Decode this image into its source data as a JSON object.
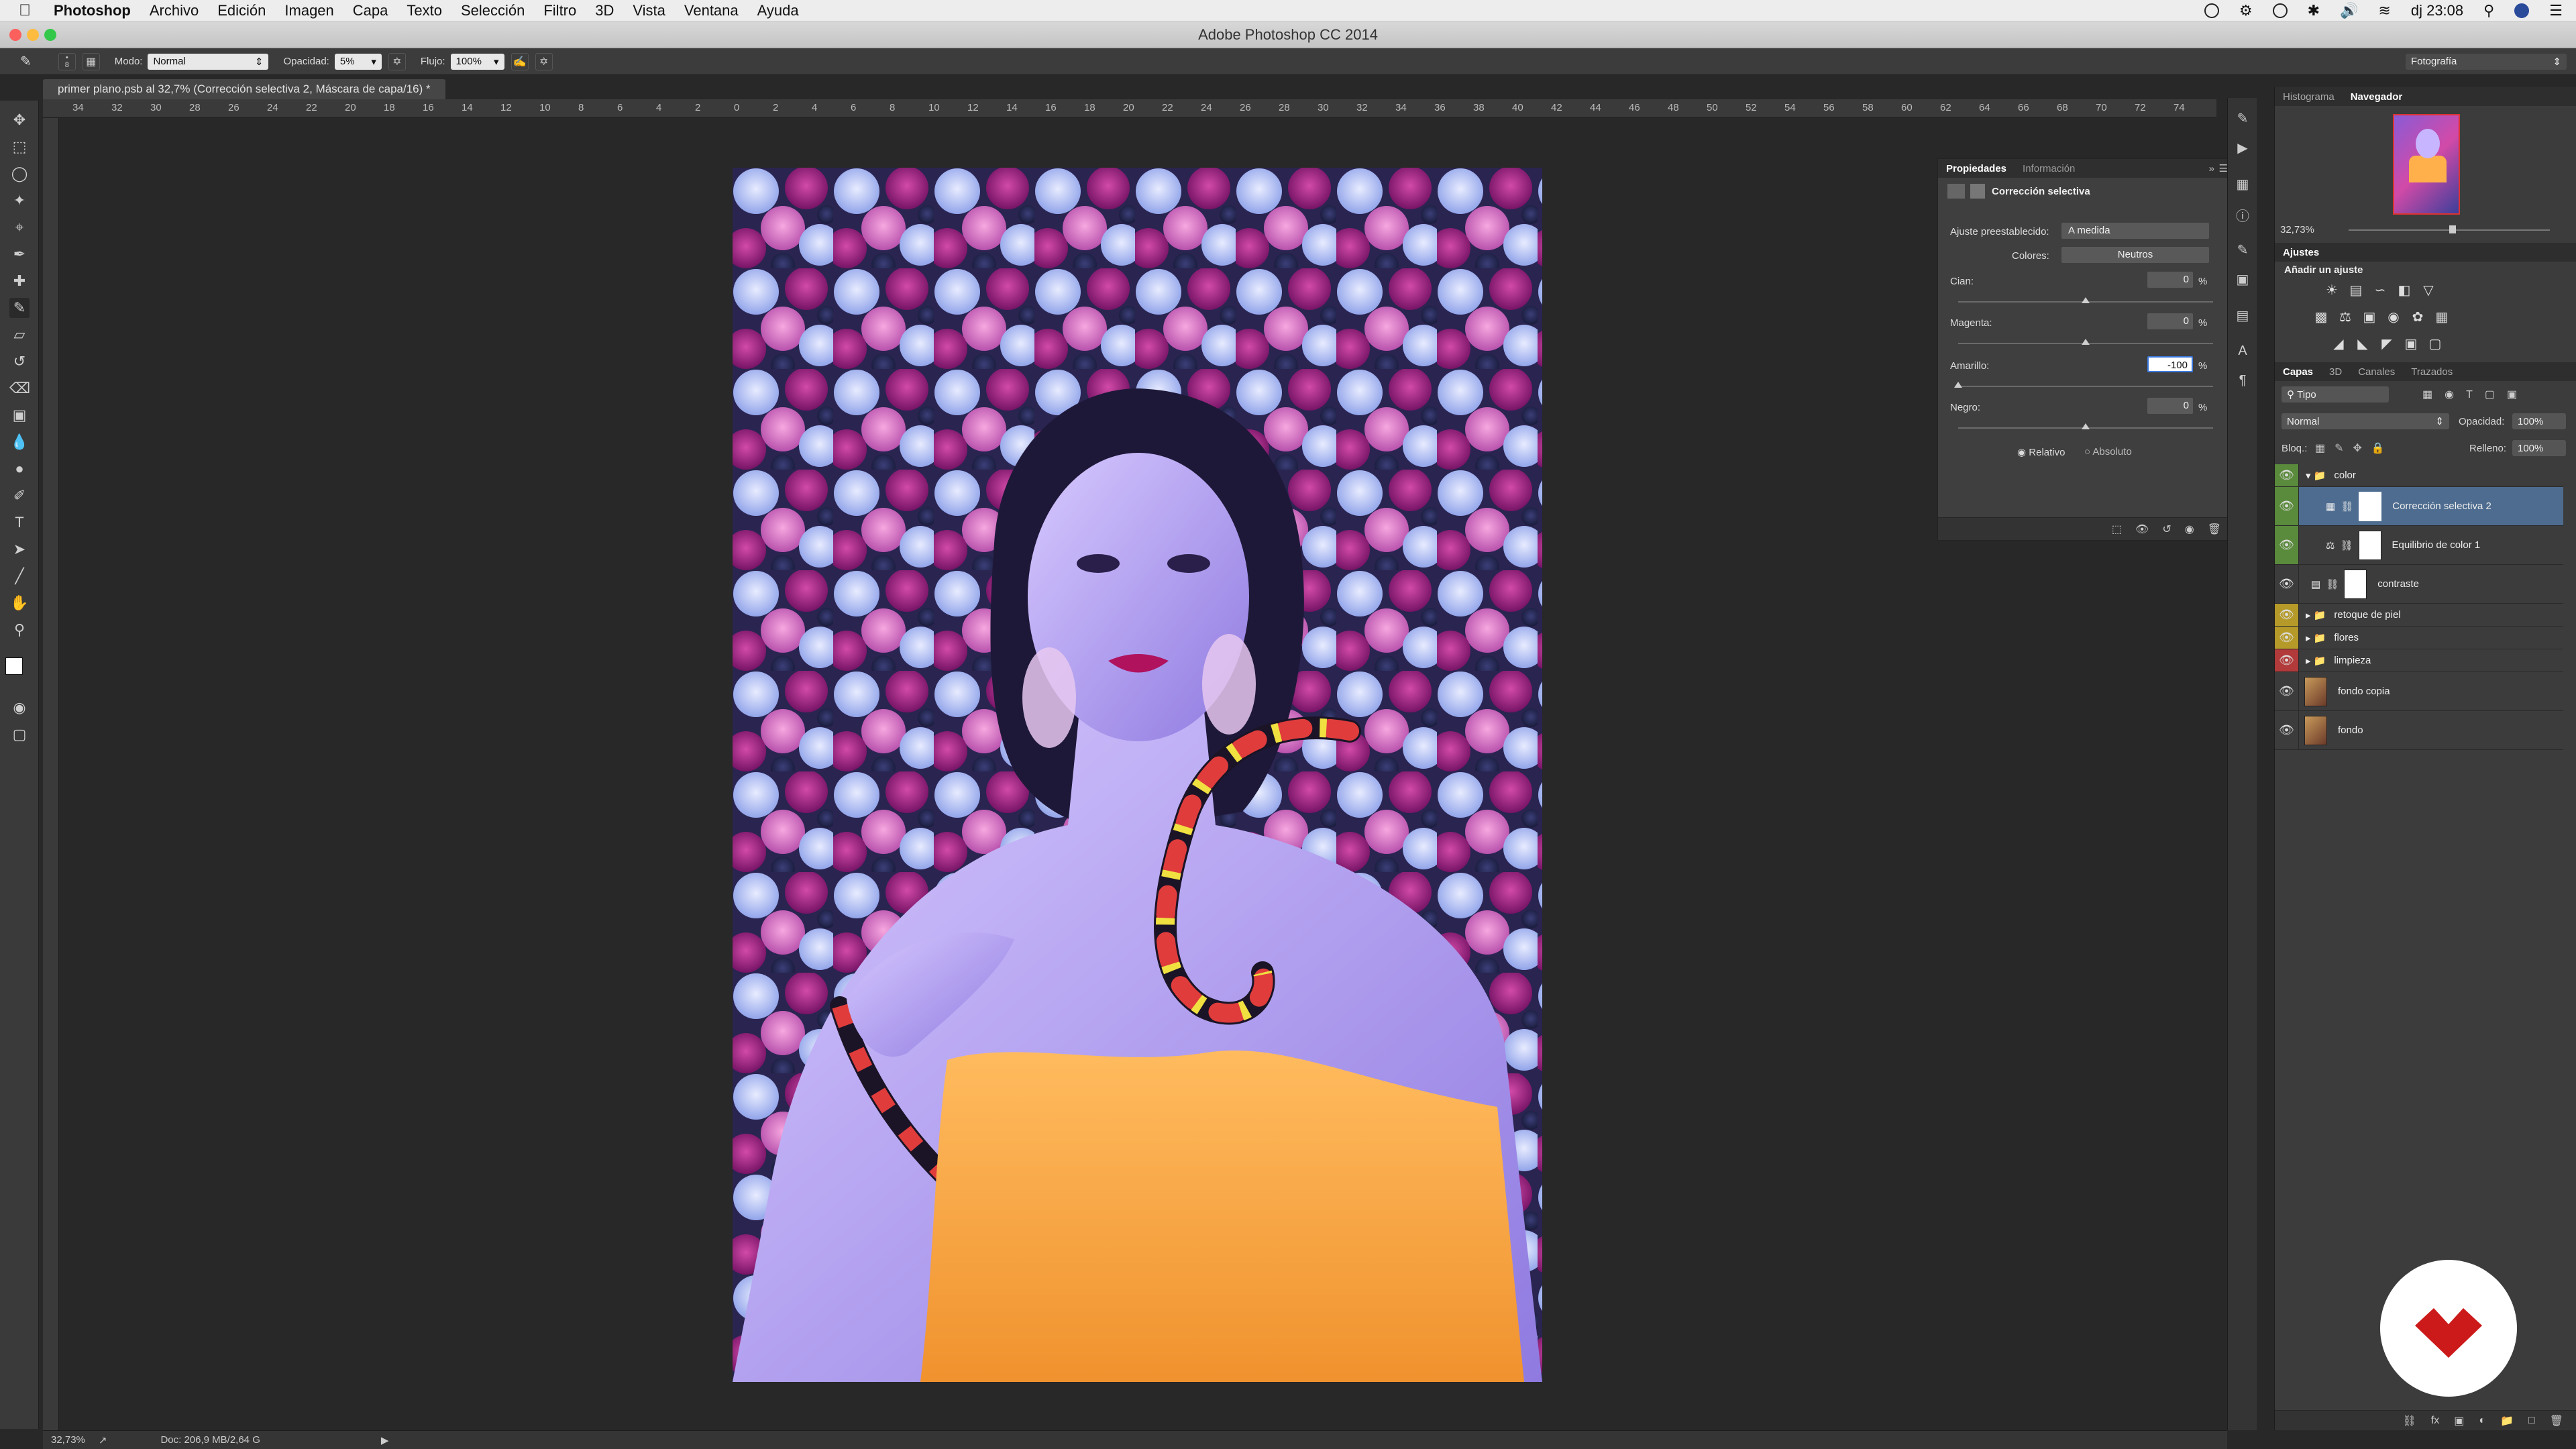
{
  "menubar": {
    "app_name": "Photoshop",
    "items": [
      "Archivo",
      "Edición",
      "Imagen",
      "Capa",
      "Texto",
      "Selección",
      "Filtro",
      "3D",
      "Vista",
      "Ventana",
      "Ayuda"
    ],
    "clock": "dj 23:08"
  },
  "window": {
    "title": "Adobe Photoshop CC 2014"
  },
  "options": {
    "brush_size": "8",
    "mode_label": "Modo:",
    "mode_value": "Normal",
    "opacity_label": "Opacidad:",
    "opacity_value": "5%",
    "flow_label": "Flujo:",
    "flow_value": "100%",
    "workspace": "Fotografía"
  },
  "document": {
    "tab_title": "primer plano.psb al 32,7% (Corrección selectiva 2, Máscara de capa/16) *",
    "ruler_labels": [
      "34",
      "32",
      "30",
      "28",
      "26",
      "24",
      "22",
      "20",
      "18",
      "16",
      "14",
      "12",
      "10",
      "8",
      "6",
      "4",
      "2",
      "0",
      "2",
      "4",
      "6",
      "8",
      "10",
      "12",
      "14",
      "16",
      "18",
      "20",
      "22",
      "24",
      "26",
      "28",
      "30",
      "32",
      "34",
      "36",
      "38",
      "40",
      "42",
      "44",
      "46",
      "48",
      "50",
      "52",
      "54",
      "56",
      "58",
      "60",
      "62",
      "64",
      "66",
      "68",
      "70",
      "72",
      "74"
    ]
  },
  "properties": {
    "tabs": [
      "Propiedades",
      "Información"
    ],
    "title": "Corrección selectiva",
    "preset_label": "Ajuste preestablecido:",
    "preset_value": "A medida",
    "colors_label": "Colores:",
    "colors_value": "Neutros",
    "sliders": [
      {
        "label": "Cian:",
        "value": "0",
        "unit": "%"
      },
      {
        "label": "Magenta:",
        "value": "0",
        "unit": "%"
      },
      {
        "label": "Amarillo:",
        "value": "-100",
        "unit": "%"
      },
      {
        "label": "Negro:",
        "value": "0",
        "unit": "%"
      }
    ],
    "radio_relative": "Relativo",
    "radio_absolute": "Absoluto"
  },
  "navigator": {
    "tabs": [
      "Histograma",
      "Navegador"
    ],
    "zoom": "32,73%"
  },
  "adjustments": {
    "tab": "Ajustes",
    "subtitle": "Añadir un ajuste"
  },
  "layers": {
    "tabs": [
      "Capas",
      "3D",
      "Canales",
      "Trazados"
    ],
    "filter": "Tipo",
    "blend_mode": "Normal",
    "opacity_label": "Opacidad:",
    "opacity_value": "100%",
    "lock_label": "Bloq.:",
    "fill_label": "Relleno:",
    "fill_value": "100%",
    "items": [
      {
        "name": "color"
      },
      {
        "name": "Corrección selectiva 2"
      },
      {
        "name": "Equilibrio de color 1"
      },
      {
        "name": "contraste"
      },
      {
        "name": "retoque de piel"
      },
      {
        "name": "flores"
      },
      {
        "name": "limpieza"
      },
      {
        "name": "fondo copia"
      },
      {
        "name": "fondo"
      }
    ]
  },
  "status": {
    "zoom": "32,73%",
    "doc": "Doc: 206,9 MB/2,64 G"
  },
  "colors": {
    "accent_selected": "#4d6c8f",
    "eye_green": "#5a8a3c",
    "eye_yellow": "#b59a2a",
    "eye_red": "#b23a3a",
    "logo_red": "#cc1a1a"
  }
}
